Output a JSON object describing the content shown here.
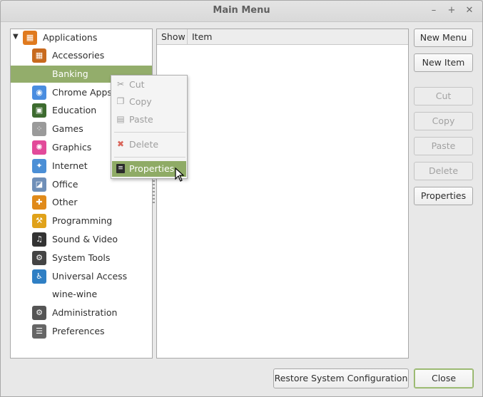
{
  "window": {
    "title": "Main Menu"
  },
  "titlebar_buttons": {
    "minimize": "–",
    "maximize": "+",
    "close": "✕"
  },
  "tree": {
    "root": "Applications",
    "items": [
      {
        "label": "Accessories",
        "icon": "calculator-icon",
        "color": "#c86a1e"
      },
      {
        "label": "Banking",
        "icon": "",
        "color": ""
      },
      {
        "label": "Chrome Apps",
        "icon": "chrome-icon",
        "color": "#4a8de0"
      },
      {
        "label": "Education",
        "icon": "chalkboard-icon",
        "color": "#3d6b2f"
      },
      {
        "label": "Games",
        "icon": "gamepad-icon",
        "color": "#9a9a9a"
      },
      {
        "label": "Graphics",
        "icon": "color-wheel-icon",
        "color": "#e24a9a"
      },
      {
        "label": "Internet",
        "icon": "globe-icon",
        "color": "#4b8fd6"
      },
      {
        "label": "Office",
        "icon": "chart-icon",
        "color": "#6f8fb8"
      },
      {
        "label": "Other",
        "icon": "puzzle-icon",
        "color": "#e08a1a"
      },
      {
        "label": "Programming",
        "icon": "construction-icon",
        "color": "#e0a21a"
      },
      {
        "label": "Sound & Video",
        "icon": "film-icon",
        "color": "#333333"
      },
      {
        "label": "System Tools",
        "icon": "gear-icon",
        "color": "#444444"
      },
      {
        "label": "Universal Access",
        "icon": "accessibility-icon",
        "color": "#2f7fc4"
      },
      {
        "label": "wine-wine",
        "icon": "",
        "color": ""
      },
      {
        "label": "Administration",
        "icon": "admin-gear-icon",
        "color": "#555555"
      },
      {
        "label": "Preferences",
        "icon": "sliders-icon",
        "color": "#666666"
      }
    ]
  },
  "columns": {
    "show": "Show",
    "item": "Item"
  },
  "buttons": {
    "new_menu": "New Menu",
    "new_item": "New Item",
    "cut": "Cut",
    "copy": "Copy",
    "paste": "Paste",
    "delete": "Delete",
    "properties": "Properties",
    "restore": "Restore System Configuration",
    "close": "Close"
  },
  "context_menu": {
    "cut": "Cut",
    "copy": "Copy",
    "paste": "Paste",
    "delete": "Delete",
    "properties": "Properties"
  },
  "colors": {
    "accent": "#93ad6b"
  }
}
